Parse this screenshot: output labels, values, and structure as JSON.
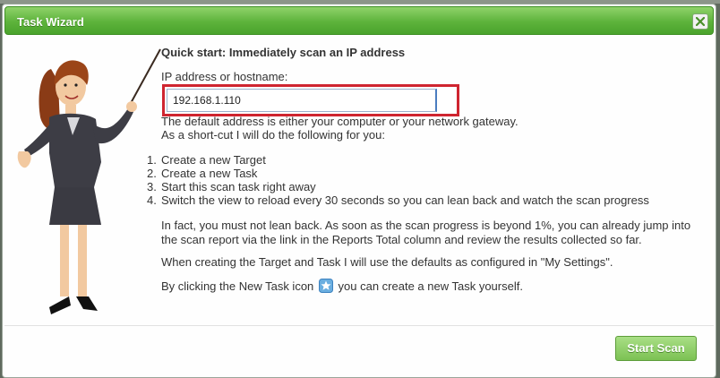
{
  "dialog": {
    "title": "Task Wizard",
    "close_icon": "close-x-icon"
  },
  "wizard": {
    "heading": "Quick start: Immediately scan an IP address",
    "ip_label": "IP address or hostname:",
    "ip_value": "192.168.1.110",
    "default_note": "The default address is either your computer or your network gateway.",
    "shortcut_note": "As a short-cut I will do the following for you:",
    "steps": [
      {
        "num": "1.",
        "text": "Create a new Target"
      },
      {
        "num": "2.",
        "text": "Create a new Task"
      },
      {
        "num": "3.",
        "text": "Start this scan task right away"
      },
      {
        "num": "4.",
        "text": "Switch the view to reload every 30 seconds so you can lean back and watch the scan progress"
      }
    ],
    "lean_back_line1": "In fact, you must not lean back. As soon as the scan progress is beyond 1%, you can already jump into",
    "lean_back_line2": "the scan report via the link in the Reports Total column and review the results collected so far.",
    "defaults_note": "When creating the Target and Task I will use the defaults as configured in \"My Settings\".",
    "new_task_before": "By clicking the New Task icon",
    "new_task_icon": "new-task-star-icon",
    "new_task_after": "you can create a new Task yourself."
  },
  "footer": {
    "start_scan_label": "Start Scan"
  },
  "colors": {
    "title_green": "#5db33b",
    "highlight_red": "#cf2530",
    "button_green": "#7cc153"
  }
}
